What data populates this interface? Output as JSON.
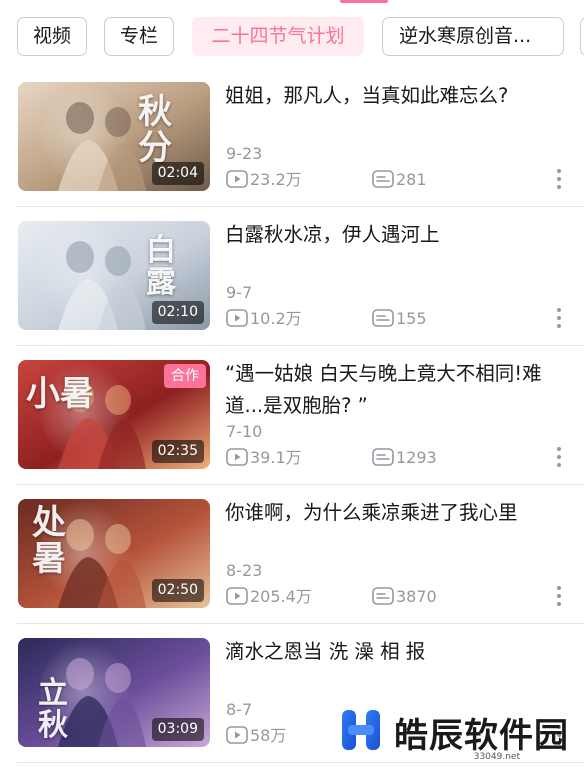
{
  "tabs": [
    {
      "label": "视频",
      "active": false
    },
    {
      "label": "专栏",
      "active": false
    },
    {
      "label": "二十四节气计划",
      "active": true
    },
    {
      "label": "逆水寒原创音...",
      "active": false
    }
  ],
  "videos": [
    {
      "title": "姐姐，那凡人，当真如此难忘么?",
      "date": "9-23",
      "views": "23.2万",
      "comments": "281",
      "duration": "02:04",
      "badge": "",
      "thumb_calligraphy": "秋分",
      "thumb_palette": [
        "#e8d7c4",
        "#b99c7e",
        "#6d5a4a"
      ]
    },
    {
      "title": "白露秋水凉，伊人遇河上",
      "date": "9-7",
      "views": "10.2万",
      "comments": "155",
      "duration": "02:10",
      "badge": "",
      "thumb_calligraphy": "白露",
      "thumb_palette": [
        "#e9edf2",
        "#c8d1dc",
        "#8c97a6"
      ]
    },
    {
      "title": "“遇一姑娘  白天与晚上竟大不相同!难道...是双胞胎? ”",
      "date": "7-10",
      "views": "39.1万",
      "comments": "1293",
      "duration": "02:35",
      "badge": "合作",
      "thumb_calligraphy": "小暑",
      "thumb_palette": [
        "#c8453e",
        "#8e2020",
        "#f0b07a"
      ]
    },
    {
      "title": "你谁啊，为什么乘凉乘进了我心里",
      "date": "8-23",
      "views": "205.4万",
      "comments": "3870",
      "duration": "02:50",
      "badge": "",
      "thumb_calligraphy": "处暑",
      "thumb_palette": [
        "#6b2b22",
        "#b5533b",
        "#e9c39a"
      ]
    },
    {
      "title": "滴水之恩当 洗 澡 相 报",
      "date": "8-7",
      "views": "58万",
      "comments": "",
      "duration": "03:09",
      "badge": "",
      "thumb_calligraphy": "立秋",
      "thumb_palette": [
        "#2b2a5a",
        "#6b4e9a",
        "#c9a9d8"
      ]
    }
  ],
  "colors": {
    "accent": "#fb7299",
    "meta": "#9499a0",
    "text": "#18191c"
  },
  "icons": {
    "views": "play-count-icon",
    "comments": "danmaku-icon",
    "more": "more-vertical-icon"
  },
  "watermark": {
    "text": "皓辰软件园",
    "url": "33049.net"
  }
}
